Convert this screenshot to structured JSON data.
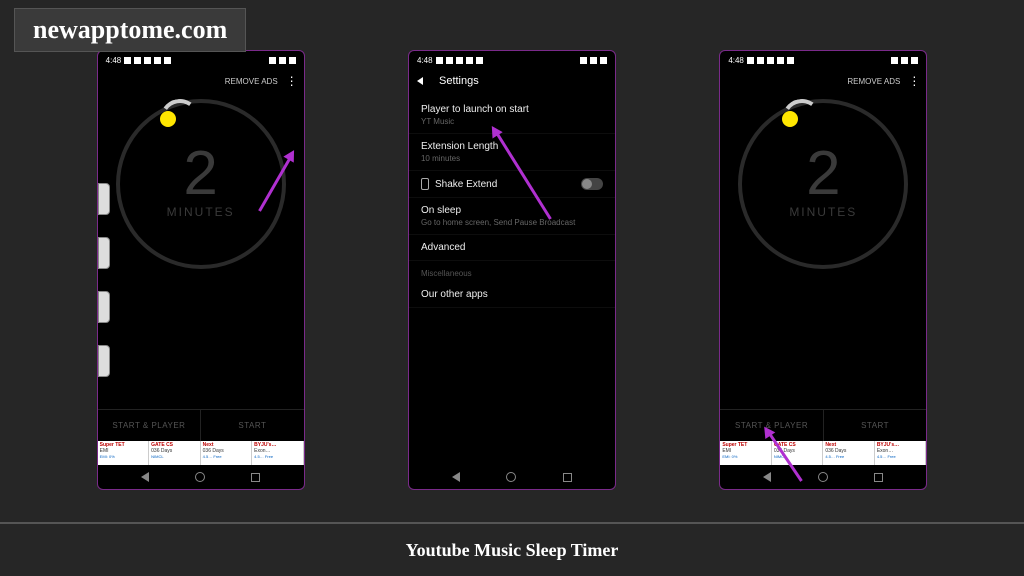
{
  "watermark": "newapptome.com",
  "caption": "Youtube Music Sleep Timer",
  "status": {
    "time": "4:48"
  },
  "timer": {
    "remove_ads": "REMOVE ADS",
    "value": "2",
    "unit": "MINUTES",
    "btn_left": "START & PLAYER",
    "btn_right": "START"
  },
  "ads": [
    {
      "l1": "Super TET",
      "l2": "EMI",
      "l3": "EMI: 0%"
    },
    {
      "l1": "GATE CS",
      "l2": "036 Days",
      "l3": "NIMCL"
    },
    {
      "l1": "Next",
      "l2": "036 Days",
      "l3": "4.5… Free"
    },
    {
      "l1": "BYJU's…",
      "l2": "Exon…",
      "l3": "4.5… Free"
    }
  ],
  "settings": {
    "title": "Settings",
    "rows": {
      "player": {
        "label": "Player to launch on start",
        "sub": "YT Music"
      },
      "ext": {
        "label": "Extension Length",
        "sub": "10 minutes"
      },
      "shake": {
        "label": "Shake Extend"
      },
      "sleep": {
        "label": "On sleep",
        "sub": "Go to home screen, Send Pause Broadcast"
      },
      "adv": {
        "label": "Advanced"
      },
      "misc_head": "Miscellaneous",
      "other": {
        "label": "Our other apps"
      }
    }
  }
}
